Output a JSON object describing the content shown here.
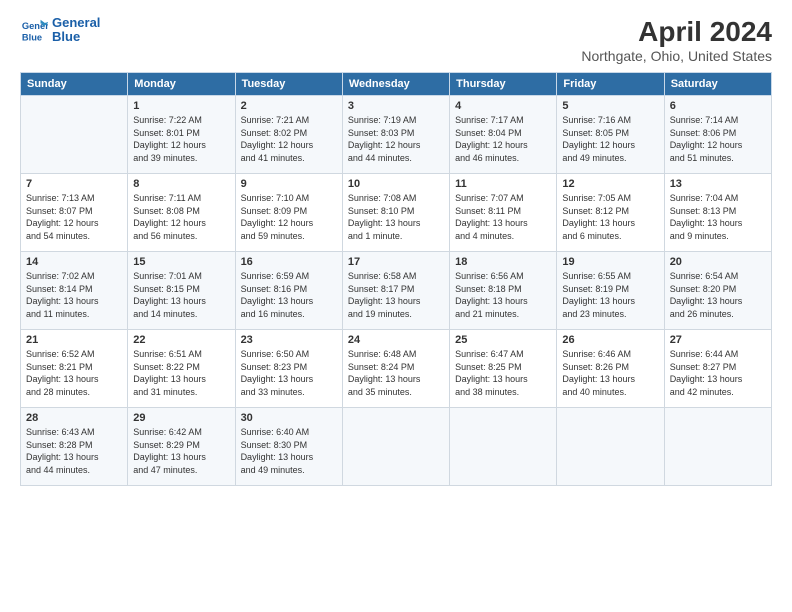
{
  "header": {
    "logo_line1": "General",
    "logo_line2": "Blue",
    "title": "April 2024",
    "subtitle": "Northgate, Ohio, United States"
  },
  "columns": [
    "Sunday",
    "Monday",
    "Tuesday",
    "Wednesday",
    "Thursday",
    "Friday",
    "Saturday"
  ],
  "weeks": [
    [
      {
        "day": "",
        "content": ""
      },
      {
        "day": "1",
        "content": "Sunrise: 7:22 AM\nSunset: 8:01 PM\nDaylight: 12 hours\nand 39 minutes."
      },
      {
        "day": "2",
        "content": "Sunrise: 7:21 AM\nSunset: 8:02 PM\nDaylight: 12 hours\nand 41 minutes."
      },
      {
        "day": "3",
        "content": "Sunrise: 7:19 AM\nSunset: 8:03 PM\nDaylight: 12 hours\nand 44 minutes."
      },
      {
        "day": "4",
        "content": "Sunrise: 7:17 AM\nSunset: 8:04 PM\nDaylight: 12 hours\nand 46 minutes."
      },
      {
        "day": "5",
        "content": "Sunrise: 7:16 AM\nSunset: 8:05 PM\nDaylight: 12 hours\nand 49 minutes."
      },
      {
        "day": "6",
        "content": "Sunrise: 7:14 AM\nSunset: 8:06 PM\nDaylight: 12 hours\nand 51 minutes."
      }
    ],
    [
      {
        "day": "7",
        "content": "Sunrise: 7:13 AM\nSunset: 8:07 PM\nDaylight: 12 hours\nand 54 minutes."
      },
      {
        "day": "8",
        "content": "Sunrise: 7:11 AM\nSunset: 8:08 PM\nDaylight: 12 hours\nand 56 minutes."
      },
      {
        "day": "9",
        "content": "Sunrise: 7:10 AM\nSunset: 8:09 PM\nDaylight: 12 hours\nand 59 minutes."
      },
      {
        "day": "10",
        "content": "Sunrise: 7:08 AM\nSunset: 8:10 PM\nDaylight: 13 hours\nand 1 minute."
      },
      {
        "day": "11",
        "content": "Sunrise: 7:07 AM\nSunset: 8:11 PM\nDaylight: 13 hours\nand 4 minutes."
      },
      {
        "day": "12",
        "content": "Sunrise: 7:05 AM\nSunset: 8:12 PM\nDaylight: 13 hours\nand 6 minutes."
      },
      {
        "day": "13",
        "content": "Sunrise: 7:04 AM\nSunset: 8:13 PM\nDaylight: 13 hours\nand 9 minutes."
      }
    ],
    [
      {
        "day": "14",
        "content": "Sunrise: 7:02 AM\nSunset: 8:14 PM\nDaylight: 13 hours\nand 11 minutes."
      },
      {
        "day": "15",
        "content": "Sunrise: 7:01 AM\nSunset: 8:15 PM\nDaylight: 13 hours\nand 14 minutes."
      },
      {
        "day": "16",
        "content": "Sunrise: 6:59 AM\nSunset: 8:16 PM\nDaylight: 13 hours\nand 16 minutes."
      },
      {
        "day": "17",
        "content": "Sunrise: 6:58 AM\nSunset: 8:17 PM\nDaylight: 13 hours\nand 19 minutes."
      },
      {
        "day": "18",
        "content": "Sunrise: 6:56 AM\nSunset: 8:18 PM\nDaylight: 13 hours\nand 21 minutes."
      },
      {
        "day": "19",
        "content": "Sunrise: 6:55 AM\nSunset: 8:19 PM\nDaylight: 13 hours\nand 23 minutes."
      },
      {
        "day": "20",
        "content": "Sunrise: 6:54 AM\nSunset: 8:20 PM\nDaylight: 13 hours\nand 26 minutes."
      }
    ],
    [
      {
        "day": "21",
        "content": "Sunrise: 6:52 AM\nSunset: 8:21 PM\nDaylight: 13 hours\nand 28 minutes."
      },
      {
        "day": "22",
        "content": "Sunrise: 6:51 AM\nSunset: 8:22 PM\nDaylight: 13 hours\nand 31 minutes."
      },
      {
        "day": "23",
        "content": "Sunrise: 6:50 AM\nSunset: 8:23 PM\nDaylight: 13 hours\nand 33 minutes."
      },
      {
        "day": "24",
        "content": "Sunrise: 6:48 AM\nSunset: 8:24 PM\nDaylight: 13 hours\nand 35 minutes."
      },
      {
        "day": "25",
        "content": "Sunrise: 6:47 AM\nSunset: 8:25 PM\nDaylight: 13 hours\nand 38 minutes."
      },
      {
        "day": "26",
        "content": "Sunrise: 6:46 AM\nSunset: 8:26 PM\nDaylight: 13 hours\nand 40 minutes."
      },
      {
        "day": "27",
        "content": "Sunrise: 6:44 AM\nSunset: 8:27 PM\nDaylight: 13 hours\nand 42 minutes."
      }
    ],
    [
      {
        "day": "28",
        "content": "Sunrise: 6:43 AM\nSunset: 8:28 PM\nDaylight: 13 hours\nand 44 minutes."
      },
      {
        "day": "29",
        "content": "Sunrise: 6:42 AM\nSunset: 8:29 PM\nDaylight: 13 hours\nand 47 minutes."
      },
      {
        "day": "30",
        "content": "Sunrise: 6:40 AM\nSunset: 8:30 PM\nDaylight: 13 hours\nand 49 minutes."
      },
      {
        "day": "",
        "content": ""
      },
      {
        "day": "",
        "content": ""
      },
      {
        "day": "",
        "content": ""
      },
      {
        "day": "",
        "content": ""
      }
    ]
  ]
}
